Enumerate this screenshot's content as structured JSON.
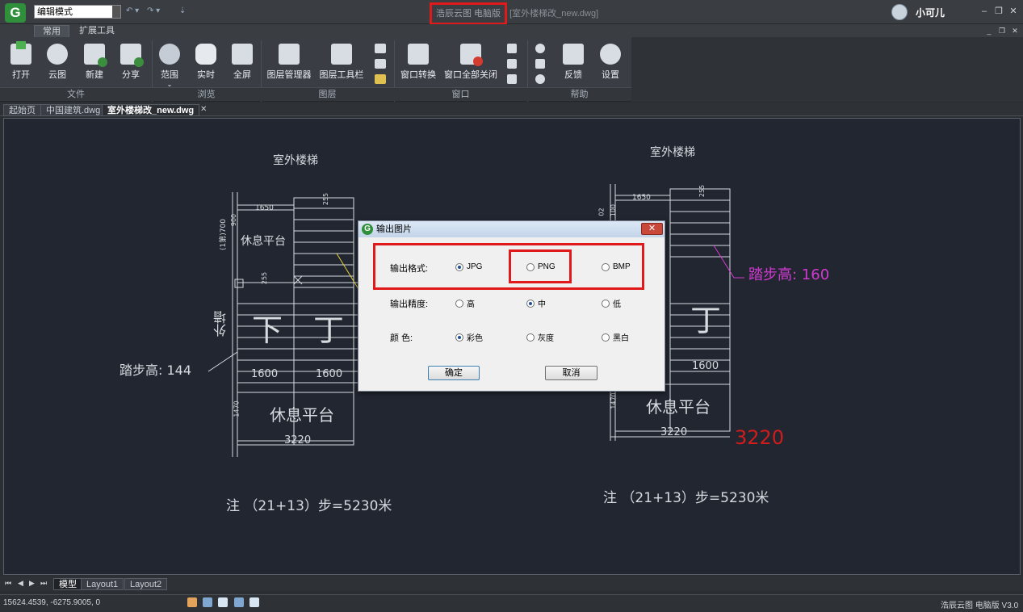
{
  "app": {
    "title_boxed": "浩辰云图 电脑版",
    "title_file": "[室外楼梯改_new.dwg]",
    "user": "小可儿",
    "mode": "编辑模式",
    "version": "浩辰云图 电脑版 V3.0",
    "logo_letter": "G"
  },
  "ribbon": {
    "tabs": [
      "常用",
      "扩展工具"
    ],
    "groups": [
      {
        "name": "文件"
      },
      {
        "name": "浏览"
      },
      {
        "name": "图层"
      },
      {
        "name": "窗口"
      },
      {
        "name": "帮助"
      }
    ],
    "tools": {
      "open": "打开",
      "cloud": "云图",
      "new": "新建",
      "share": "分享",
      "range": "范围",
      "realtime": "实时",
      "fullscreen": "全屏",
      "layer_manager": "图层管理器",
      "layer_toolbar": "图层工具栏",
      "window_switch": "窗口转换",
      "close_all": "窗口全部关闭",
      "feedback": "反馈",
      "settings": "设置"
    }
  },
  "doc_tabs": [
    "起始页",
    "中国建筑.dwg",
    "室外楼梯改_new.dwg"
  ],
  "drawing": {
    "left_title": "室外楼梯",
    "right_title": "室外楼梯",
    "left_platform": "休息平台",
    "right_platform": "休息平台",
    "left_note": "注 （21+13）步=5230米",
    "right_note": "注 （21+13）步=5230米",
    "left_step": "踏步高: 144",
    "right_step": "踏步高: 160",
    "wall": "外墙",
    "down": "下",
    "up": "丁",
    "right_up": "丁",
    "dim_1650a": "1650",
    "dim_1650b": "1650",
    "dim_1600a": "1600",
    "dim_1600b": "1600",
    "dim_1600c": "1600",
    "dim_3220a": "3220",
    "dim_3220b": "3220",
    "dim_3220_red": "3220",
    "dim_255a": "255",
    "dim_255b": "255",
    "dim_255c": "255",
    "dim_900": "900",
    "dim_700": "(1第)700",
    "dim_1470a": "1470",
    "dim_1470b": "1470",
    "dim_100": "100",
    "dim_02": "02",
    "small_platform": "休息平台"
  },
  "dialog": {
    "title": "输出图片",
    "format_label": "输出格式:",
    "precision_label": "输出精度:",
    "color_label": "颜 色:",
    "formats": [
      "JPG",
      "PNG",
      "BMP"
    ],
    "format_selected": "JPG",
    "precisions": [
      "高",
      "中",
      "低"
    ],
    "precision_selected": "中",
    "colors": [
      "彩色",
      "灰度",
      "黑白"
    ],
    "color_selected": "彩色",
    "ok": "确定",
    "cancel": "取消",
    "close": "✕"
  },
  "layout_tabs": [
    "模型",
    "Layout1",
    "Layout2"
  ],
  "status": {
    "coords": "15624.4539, -6275.9005, 0"
  }
}
